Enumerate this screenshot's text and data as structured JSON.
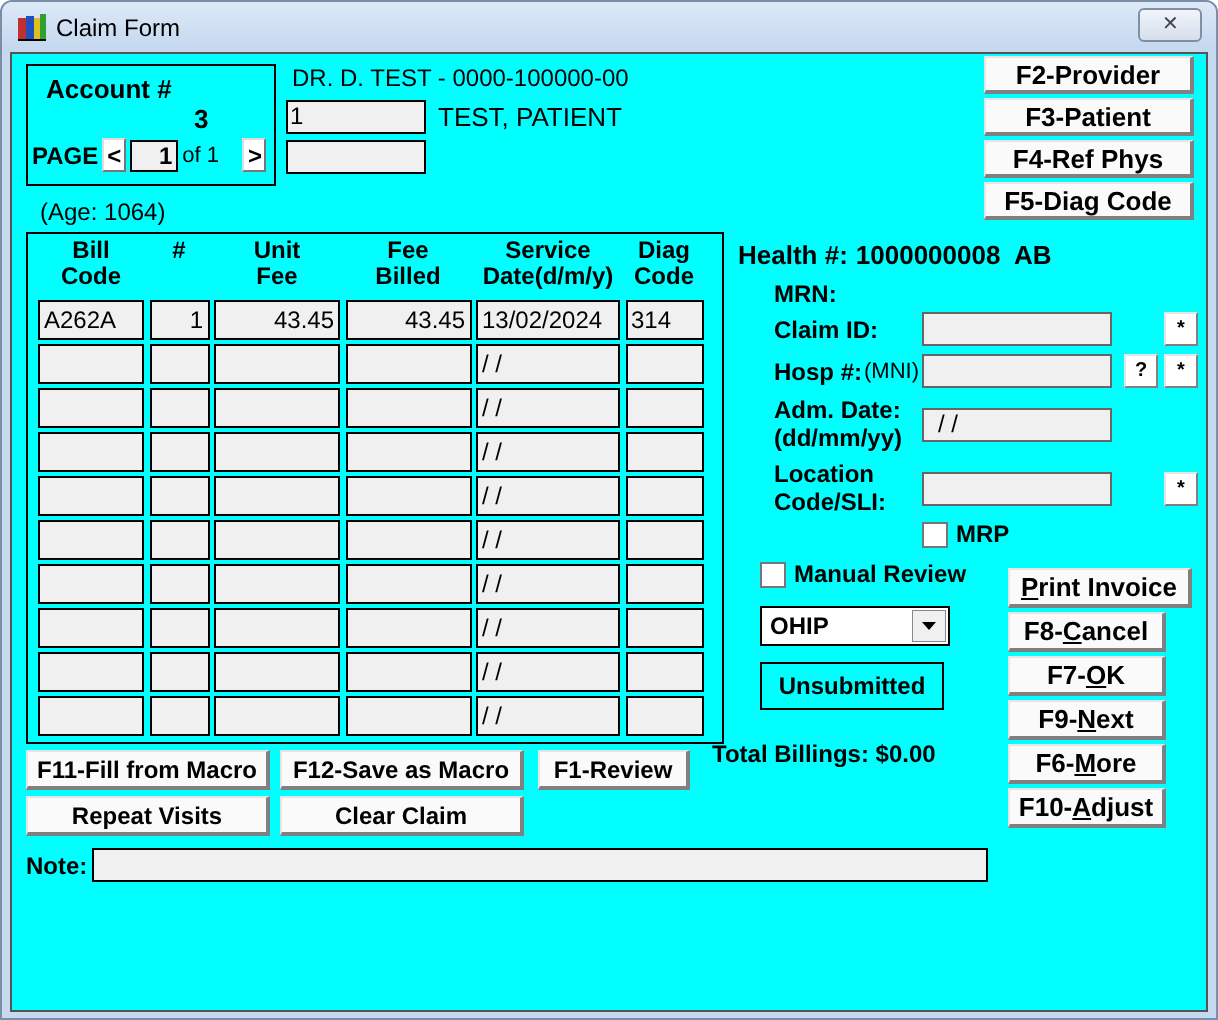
{
  "window": {
    "title": "Claim Form",
    "close": "✕"
  },
  "account": {
    "label": "Account #",
    "number": "3",
    "page_label": "PAGE",
    "page_prev": "<",
    "page": "1",
    "page_of": "of 1",
    "page_next": ">"
  },
  "provider": "DR. D. TEST - 0000-100000-00",
  "patient": {
    "id": "1",
    "name": "TEST, PATIENT",
    "age": "(Age: 1064)"
  },
  "top_buttons": [
    "F2-Provider",
    "F3-Patient",
    "F4-Ref Phys",
    "F5-Diag Code"
  ],
  "table": {
    "columns": [
      [
        "Bill",
        "Code"
      ],
      [
        "#"
      ],
      [
        "Unit",
        "Fee"
      ],
      [
        "Fee",
        "Billed"
      ],
      [
        "Service",
        "Date(d/m/y)"
      ],
      [
        "Diag",
        "Code"
      ]
    ],
    "rows": [
      {
        "bill_code": "A262A",
        "units": "1",
        "unit_fee": "43.45",
        "fee_billed": "43.45",
        "service_date": "13/02/2024",
        "diag_code": "314"
      },
      {
        "service_date": "/ /"
      },
      {
        "service_date": "/ /"
      },
      {
        "service_date": "/ /"
      },
      {
        "service_date": "/ /"
      },
      {
        "service_date": "/ /"
      },
      {
        "service_date": "/ /"
      },
      {
        "service_date": "/ /"
      },
      {
        "service_date": "/ /"
      },
      {
        "service_date": "/ /"
      }
    ]
  },
  "health": {
    "label": "Health #:",
    "value": "1000000008  AB"
  },
  "details": [
    {
      "kind": "label",
      "label": [
        "MRN:"
      ]
    },
    {
      "kind": "field",
      "label": [
        "Claim ID:"
      ],
      "buttons": [
        "*"
      ]
    },
    {
      "kind": "field",
      "label": [
        "Hosp #:"
      ],
      "note": "(MNI)",
      "buttons": [
        "?",
        "*"
      ]
    },
    {
      "kind": "field",
      "label": [
        "Adm. Date:",
        "(dd/mm/yy)"
      ],
      "value": "/ /"
    },
    {
      "kind": "field",
      "label": [
        "Location",
        "Code/SLI:"
      ],
      "buttons": [
        "*"
      ]
    }
  ],
  "mrp": {
    "label": "MRP",
    "checked": false
  },
  "manual_review": {
    "label": "Manual Review",
    "checked": false
  },
  "payer": {
    "value": "OHIP"
  },
  "status": "Unsubmitted",
  "total": "Total Billings: $0.00",
  "action_buttons": [
    {
      "key": "P",
      "after": "rint Invoice"
    },
    {
      "before": "F8-",
      "key": "C",
      "after": "ancel"
    },
    {
      "before": "F7-",
      "key": "O",
      "after": "K"
    },
    {
      "before": "F9-",
      "key": "N",
      "after": "ext"
    },
    {
      "before": "F6-",
      "key": "M",
      "after": "ore"
    },
    {
      "before": "F10-",
      "key": "A",
      "after": "djust"
    }
  ],
  "macro_buttons": [
    "F11-Fill from Macro",
    "F12-Save as Macro",
    "F1-Review"
  ],
  "bottom_buttons": [
    "Repeat Visits",
    "Clear Claim"
  ],
  "note": {
    "label": "Note:"
  }
}
